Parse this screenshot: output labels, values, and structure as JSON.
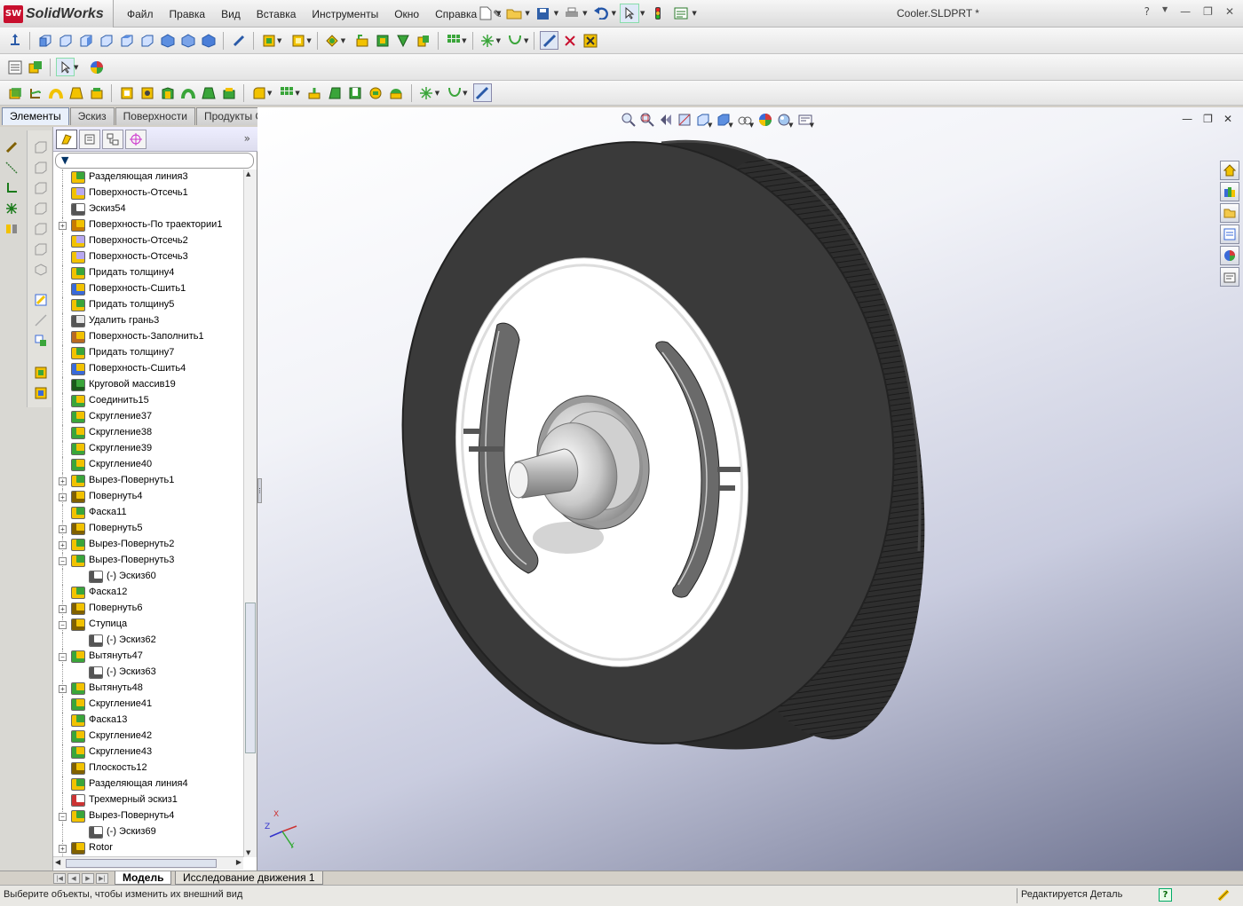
{
  "app": {
    "logo_text": "SolidWorks",
    "logo_badge": "SW",
    "document_title": "Cooler.SLDPRT *"
  },
  "menu": [
    "Файл",
    "Правка",
    "Вид",
    "Вставка",
    "Инструменты",
    "Окно",
    "Справка"
  ],
  "command_tabs": [
    {
      "label": "Элементы",
      "active": true
    },
    {
      "label": "Эскиз",
      "active": false
    },
    {
      "label": "Поверхности",
      "active": false
    },
    {
      "label": "Продукты Office",
      "active": false
    }
  ],
  "feature_tree": [
    {
      "label": "Разделяющая линия3",
      "expander": "",
      "icon": "split-line-icon",
      "indent": 0
    },
    {
      "label": "Поверхность-Отсечь1",
      "expander": "",
      "icon": "surface-trim-icon",
      "indent": 0
    },
    {
      "label": "Эскиз54",
      "expander": "",
      "icon": "sketch-icon",
      "indent": 0
    },
    {
      "label": "Поверхность-По траектории1",
      "expander": "+",
      "icon": "surface-sweep-icon",
      "indent": 0
    },
    {
      "label": "Поверхность-Отсечь2",
      "expander": "",
      "icon": "surface-trim-icon",
      "indent": 0
    },
    {
      "label": "Поверхность-Отсечь3",
      "expander": "",
      "icon": "surface-trim-icon",
      "indent": 0
    },
    {
      "label": "Придать толщину4",
      "expander": "",
      "icon": "thicken-icon",
      "indent": 0
    },
    {
      "label": "Поверхность-Сшить1",
      "expander": "",
      "icon": "surface-knit-icon",
      "indent": 0
    },
    {
      "label": "Придать толщину5",
      "expander": "",
      "icon": "thicken-icon",
      "indent": 0
    },
    {
      "label": "Удалить грань3",
      "expander": "",
      "icon": "delete-face-icon",
      "indent": 0
    },
    {
      "label": "Поверхность-Заполнить1",
      "expander": "",
      "icon": "surface-fill-icon",
      "indent": 0
    },
    {
      "label": "Придать толщину7",
      "expander": "",
      "icon": "thicken-icon",
      "indent": 0
    },
    {
      "label": "Поверхность-Сшить4",
      "expander": "",
      "icon": "surface-knit-icon",
      "indent": 0
    },
    {
      "label": "Круговой массив19",
      "expander": "",
      "icon": "circular-pattern-icon",
      "indent": 0
    },
    {
      "label": "Соединить15",
      "expander": "",
      "icon": "combine-icon",
      "indent": 0
    },
    {
      "label": "Скругление37",
      "expander": "",
      "icon": "fillet-icon",
      "indent": 0
    },
    {
      "label": "Скругление38",
      "expander": "",
      "icon": "fillet-icon",
      "indent": 0
    },
    {
      "label": "Скругление39",
      "expander": "",
      "icon": "fillet-icon",
      "indent": 0
    },
    {
      "label": "Скругление40",
      "expander": "",
      "icon": "fillet-icon",
      "indent": 0
    },
    {
      "label": "Вырез-Повернуть1",
      "expander": "+",
      "icon": "cut-revolve-icon",
      "indent": 0
    },
    {
      "label": "Повернуть4",
      "expander": "+",
      "icon": "revolve-icon",
      "indent": 0
    },
    {
      "label": "Фаска11",
      "expander": "",
      "icon": "chamfer-icon",
      "indent": 0
    },
    {
      "label": "Повернуть5",
      "expander": "+",
      "icon": "revolve-icon",
      "indent": 0
    },
    {
      "label": "Вырез-Повернуть2",
      "expander": "+",
      "icon": "cut-revolve-icon",
      "indent": 0
    },
    {
      "label": "Вырез-Повернуть3",
      "expander": "−",
      "icon": "cut-revolve-icon",
      "indent": 0
    },
    {
      "label": "(-) Эскиз60",
      "expander": "",
      "icon": "sketch-icon",
      "indent": 1
    },
    {
      "label": "Фаска12",
      "expander": "",
      "icon": "chamfer-icon",
      "indent": 0
    },
    {
      "label": "Повернуть6",
      "expander": "+",
      "icon": "revolve-icon",
      "indent": 0
    },
    {
      "label": "Ступица",
      "expander": "−",
      "icon": "revolve-icon",
      "indent": 0
    },
    {
      "label": "(-) Эскиз62",
      "expander": "",
      "icon": "sketch-icon",
      "indent": 1
    },
    {
      "label": "Вытянуть47",
      "expander": "−",
      "icon": "extrude-icon",
      "indent": 0
    },
    {
      "label": "(-) Эскиз63",
      "expander": "",
      "icon": "sketch-icon",
      "indent": 1
    },
    {
      "label": "Вытянуть48",
      "expander": "+",
      "icon": "extrude-icon",
      "indent": 0
    },
    {
      "label": "Скругление41",
      "expander": "",
      "icon": "fillet-icon",
      "indent": 0
    },
    {
      "label": "Фаска13",
      "expander": "",
      "icon": "chamfer-icon",
      "indent": 0
    },
    {
      "label": "Скругление42",
      "expander": "",
      "icon": "fillet-icon",
      "indent": 0
    },
    {
      "label": "Скругление43",
      "expander": "",
      "icon": "fillet-icon",
      "indent": 0
    },
    {
      "label": "Плоскость12",
      "expander": "",
      "icon": "plane-icon",
      "indent": 0
    },
    {
      "label": "Разделяющая линия4",
      "expander": "",
      "icon": "split-line-icon",
      "indent": 0
    },
    {
      "label": "Трехмерный эскиз1",
      "expander": "",
      "icon": "3d-sketch-icon",
      "indent": 0
    },
    {
      "label": "Вырез-Повернуть4",
      "expander": "−",
      "icon": "cut-revolve-icon",
      "indent": 0
    },
    {
      "label": "(-) Эскиз69",
      "expander": "",
      "icon": "sketch-icon",
      "indent": 1
    },
    {
      "label": "Rotor",
      "expander": "+",
      "icon": "revolve-icon",
      "indent": 0
    }
  ],
  "bottom_tabs": [
    {
      "label": "Модель",
      "active": true
    },
    {
      "label": "Исследование движения 1",
      "active": false
    }
  ],
  "status": {
    "left": "Выберите объекты, чтобы изменить их внешний вид",
    "right": "Редактируется Деталь",
    "help_glyph": "?"
  },
  "triad": {
    "x": "X",
    "y": "Y",
    "z": "Z"
  },
  "colors": {
    "accent": "#c8102e",
    "feature_green": "#3aa53a",
    "feature_yellow": "#f2c200",
    "tire": "#2a2a2a",
    "rim": "#ffffff"
  }
}
